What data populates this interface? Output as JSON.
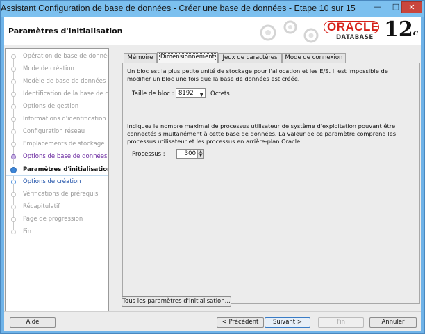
{
  "window": {
    "title": "Assistant Configuration de base de données - Créer une base de données - Etape 10 sur 15"
  },
  "header": {
    "page_title": "Paramètres d'initialisation",
    "brand_name": "ORACLE",
    "brand_product": "DATABASE",
    "brand_version": "12",
    "brand_version_suffix": "c"
  },
  "nav": {
    "items": [
      {
        "label": "Opération de base de données",
        "state": "disabled"
      },
      {
        "label": "Mode de création",
        "state": "disabled"
      },
      {
        "label": "Modèle de base de données",
        "state": "disabled"
      },
      {
        "label": "Identification de la base de don",
        "state": "disabled"
      },
      {
        "label": "Options de gestion",
        "state": "disabled"
      },
      {
        "label": "Informations d'identification de",
        "state": "disabled"
      },
      {
        "label": "Configuration réseau",
        "state": "disabled"
      },
      {
        "label": "Emplacements de stockage",
        "state": "disabled"
      },
      {
        "label": "Options de base de données",
        "state": "visited"
      },
      {
        "label": "Paramètres d'initialisation",
        "state": "current"
      },
      {
        "label": "Options de création",
        "state": "next"
      },
      {
        "label": "Vérifications de prérequis",
        "state": "disabled"
      },
      {
        "label": "Récapitulatif",
        "state": "disabled"
      },
      {
        "label": "Page de progression",
        "state": "disabled"
      },
      {
        "label": "Fin",
        "state": "disabled"
      }
    ]
  },
  "tabs": [
    {
      "label": "Mémoire",
      "active": false
    },
    {
      "label": "Dimensionnement",
      "active": true
    },
    {
      "label": "Jeux de caractères",
      "active": false
    },
    {
      "label": "Mode de connexion",
      "active": false
    }
  ],
  "sizing": {
    "block_info": "Un bloc est la plus petite unité de stockage pour l'allocation et les E/S. Il est impossible de modifier un bloc une fois que la base de données est créée.",
    "block_size_label": "Taille de bloc :",
    "block_size_value": "8192",
    "block_size_unit": "Octets",
    "process_info": "Indiquez le nombre maximal de processus utilisateur de système d'exploitation pouvant être connectés simultanément à cette base de données. La valeur de ce paramètre comprend les processus utilisateur et les processus en arrière-plan Oracle.",
    "processes_label": "Processus :",
    "processes_value": "300"
  },
  "buttons": {
    "all_params": "Tous les paramètres d'initialisation...",
    "help": "Aide",
    "back": "< Précédent",
    "next": "Suivant >",
    "finish": "Fin",
    "cancel": "Annuler"
  },
  "colors": {
    "title_bar": "#7cc0ef",
    "oracle_red": "#d6211a",
    "visited_link": "#6b2aa0",
    "current_marker": "#3d86d8"
  }
}
